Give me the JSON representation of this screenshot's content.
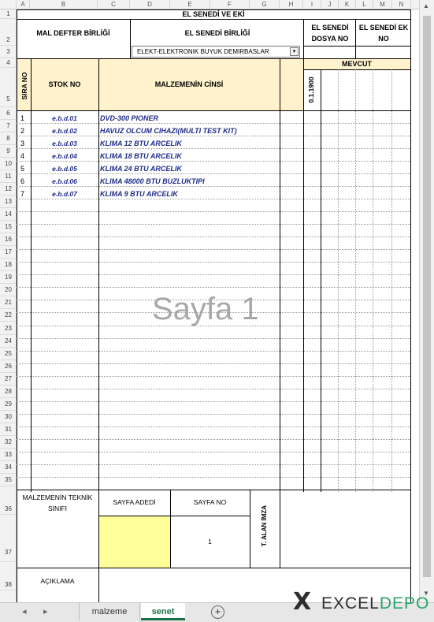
{
  "columns": [
    "A",
    "B",
    "C",
    "D",
    "E",
    "F",
    "G",
    "H",
    "I",
    "J",
    "K",
    "L",
    "M",
    "N"
  ],
  "row_numbers": [
    "1",
    "2",
    "3",
    "4",
    "5",
    "6",
    "7",
    "8",
    "9",
    "10",
    "11",
    "12",
    "13",
    "14",
    "15",
    "16",
    "17",
    "18",
    "19",
    "20",
    "21",
    "22",
    "23",
    "24",
    "25",
    "26",
    "27",
    "28",
    "29",
    "30",
    "31",
    "32",
    "33",
    "34",
    "35",
    "36",
    "37",
    "38"
  ],
  "header": {
    "title": "EL SENEDİ VE EKİ",
    "mal_defter_birligi": "MAL DEFTER BİRLİĞİ",
    "el_senedi_birligi": "EL SENEDİ BİRLİĞİ",
    "el_senedi_dosya_no": "EL SENEDİ DOSYA NO",
    "el_senedi_ek_no": "EL SENEDİ EK NO",
    "dropdown_value": "ELEKT-ELEKTRONIK BUYUK DEMIRBASLAR",
    "sira_no": "SIRA NO",
    "stok_no": "STOK NO",
    "malzeme_cinsi": "MALZEMENİN CİNSİ",
    "mevcut": "MEVCUT",
    "date_col": "0.1.1900"
  },
  "items": [
    {
      "no": "1",
      "code": "e.b.d.01",
      "name": "DVD-300 PIONER"
    },
    {
      "no": "2",
      "code": "e.b.d.02",
      "name": "HAVUZ OLCUM CIHAZI(MULTI TEST KIT)"
    },
    {
      "no": "3",
      "code": "e.b.d.03",
      "name": "KLIMA 12 BTU ARCELIK"
    },
    {
      "no": "4",
      "code": "e.b.d.04",
      "name": "KLIMA 18 BTU ARCELIK"
    },
    {
      "no": "5",
      "code": "e.b.d.05",
      "name": "KLIMA 24 BTU ARCELIK"
    },
    {
      "no": "6",
      "code": "e.b.d.06",
      "name": "KLIMA 48000 BTU BUZLUKTIPI"
    },
    {
      "no": "7",
      "code": "e.b.d.07",
      "name": "KLIMA 9 BTU ARCELIK"
    }
  ],
  "watermark": "Sayfa 1",
  "footer": {
    "teknik_sinifi": "MALZEMENİN TEKNİK SINIFI",
    "sayfa_adedi": "SAYFA ADEDİ",
    "sayfa_no": "SAYFA NO",
    "sayfa_no_value": "1",
    "t_alan_imza": "T. ALAN İMZA",
    "aciklama": "AÇIKLAMA"
  },
  "tabs": {
    "sheet1": "malzeme",
    "active": "senet"
  },
  "logo": {
    "brand": "EXCELDEPO",
    "brand_part1": "EXCEL",
    "brand_part2": "DEPO"
  },
  "colors": {
    "header_fill": "#fff2cc",
    "yellow_cell": "#ffff99",
    "item_blue": "#1f2c8c",
    "active_tab": "#1e7145"
  }
}
